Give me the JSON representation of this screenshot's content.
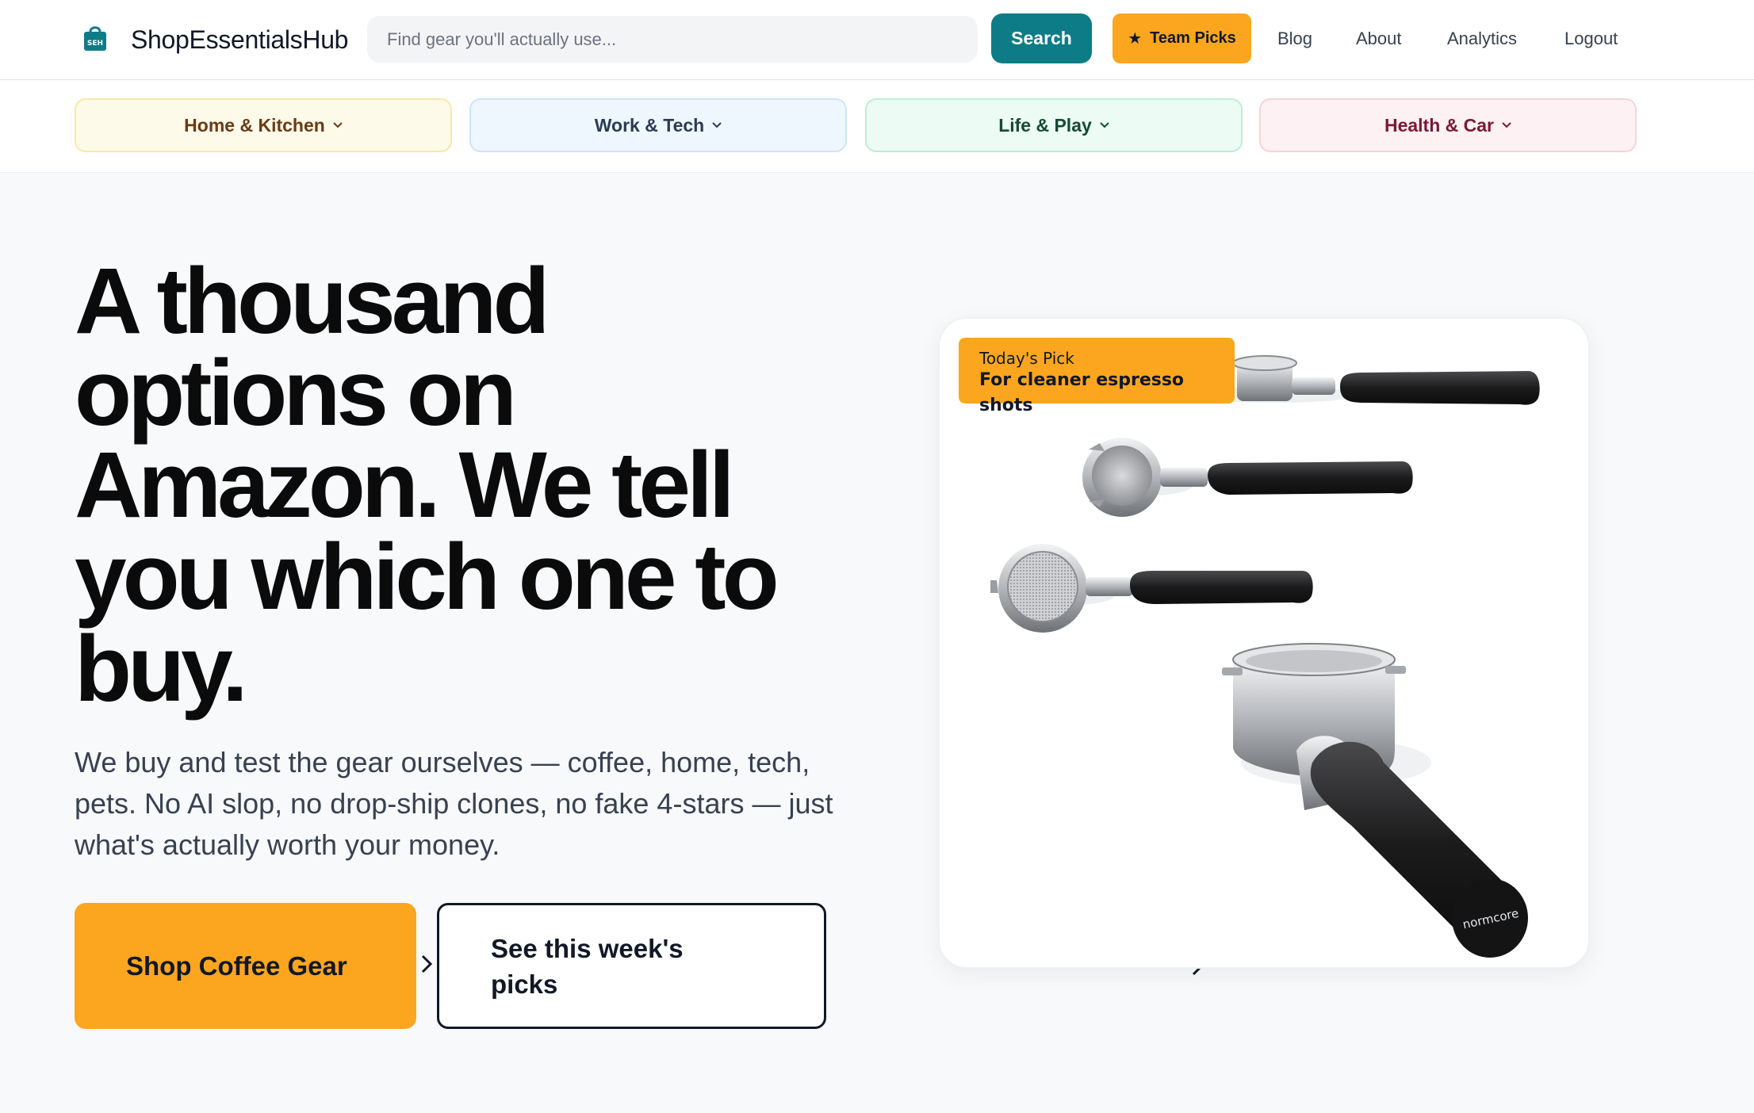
{
  "header": {
    "logo_badge": "SEH",
    "logo_text": "ShopEssentialsHub",
    "search_placeholder": "Find gear you'll actually use...",
    "search_button": "Search",
    "team_picks_label": "Team Picks",
    "nav": [
      "Blog",
      "About",
      "Analytics",
      "Logout"
    ]
  },
  "categories": [
    {
      "label": "Home & Kitchen"
    },
    {
      "label": "Work & Tech"
    },
    {
      "label": "Life & Play"
    },
    {
      "label": "Health & Car"
    }
  ],
  "hero": {
    "title": "A thousand options on Amazon. We tell you which one to buy.",
    "subtitle": "We buy and test the gear ourselves — coffee, home, tech, pets. No AI slop, no drop-ship clones, no fake 4-stars — just what's actually worth your money.",
    "cta_primary": "Shop Coffee Gear",
    "cta_secondary": "See this week's picks"
  },
  "feature": {
    "badge_kicker": "Today's Pick",
    "badge_title": "For cleaner espresso shots",
    "brand_mark": "normcore"
  },
  "colors": {
    "brand_teal": "#0e7c86",
    "accent_orange": "#fba61e",
    "page_bg": "#f8f9fb"
  }
}
